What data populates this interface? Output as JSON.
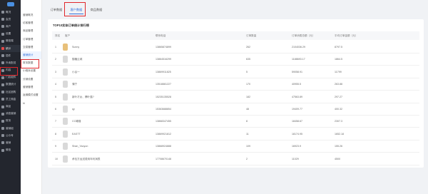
{
  "sidebar_main": {
    "items": [
      {
        "label": "概况",
        "active": false
      },
      {
        "label": "会员",
        "active": false
      },
      {
        "label": "商户",
        "active": false
      },
      {
        "label": "设置",
        "active": false
      },
      {
        "label": "微信端",
        "active": false
      },
      {
        "label": "统计",
        "active": true
      },
      {
        "label": "插件",
        "active": false
      },
      {
        "label": "外卖配送",
        "active": false
      },
      {
        "label": "内容",
        "active": false
      },
      {
        "label": "门店组件",
        "active": false
      },
      {
        "label": "数据统计",
        "active": false
      },
      {
        "label": "社区团购",
        "active": false
      },
      {
        "label": "员工佣金",
        "active": false
      },
      {
        "label": "商品",
        "active": false
      },
      {
        "label": "消息营销",
        "active": false
      },
      {
        "label": "财务",
        "active": false
      },
      {
        "label": "营销组",
        "active": false
      },
      {
        "label": "公众号",
        "active": false
      },
      {
        "label": "营销",
        "active": false
      },
      {
        "label": "微信",
        "active": false
      }
    ]
  },
  "sidebar_sub": {
    "items": [
      {
        "label": "营销概况",
        "active": false
      },
      {
        "label": "访客管理",
        "active": false
      },
      {
        "label": "商品管理",
        "active": false
      },
      {
        "label": "订单管理",
        "active": false
      },
      {
        "label": "交易管理",
        "active": false
      },
      {
        "label": "营销统计",
        "active": true
      },
      {
        "label": "财务数据",
        "active": false
      },
      {
        "label": "小程序设置",
        "active": false
      },
      {
        "label": "分销设置",
        "active": false
      },
      {
        "label": "营销管理",
        "active": false
      },
      {
        "label": "返佣模式设置",
        "active": false
      },
      {
        "label": "hi",
        "active": false
      }
    ]
  },
  "tabs": [
    {
      "label": "订单数据",
      "active": false
    },
    {
      "label": "客户数据",
      "active": true
    },
    {
      "label": "商品数据",
      "active": false
    }
  ],
  "card": {
    "title": "TOP10实体订单统计排行榜",
    "columns": [
      "排名",
      "客户",
      "联系电话",
      "订单数量",
      "订单消费总额（元）",
      "平均订单金额（元）"
    ],
    "rows": [
      {
        "rank": "1",
        "name": "Sunny",
        "phone": "13865874899",
        "count": "262",
        "total": "2104036.29",
        "avg": "8797.5"
      },
      {
        "rank": "2",
        "name": "御膳云城",
        "phone": "13864516299",
        "count": "635",
        "total": "1188693.17",
        "avg": "1864.5"
      },
      {
        "rank": "3",
        "name": "小谷一",
        "phone": "13869911825",
        "count": "5",
        "total": "59058.91",
        "avg": "11799"
      },
      {
        "rank": "4",
        "name": "蒲宁",
        "phone": "13518881227",
        "count": "170",
        "total": "40955.5",
        "avg": "263.88"
      },
      {
        "rank": "5",
        "name": "新叶才女、腾叶猫?",
        "phone": "15235135528",
        "count": "182",
        "total": "47563.89",
        "avg": "297.27"
      },
      {
        "rank": "6",
        "name": "qy",
        "phone": "15363688854",
        "count": "48",
        "total": "19409.77",
        "avg": "400.32"
      },
      {
        "rank": "7",
        "name": "CC曦瑾",
        "phone": "13868347455",
        "count": "8",
        "total": "18458.67",
        "avg": "2307.3"
      },
      {
        "rank": "8",
        "name": "EASTT",
        "phone": "13869921812",
        "count": "11",
        "total": "18174.95",
        "avg": "1652.18"
      },
      {
        "rank": "9",
        "name": "Shan_Yaoyun",
        "phone": "13868924888",
        "count": "109",
        "total": "16923.9",
        "avg": "155.26"
      },
      {
        "rank": "10",
        "name": "承包方运送费用年利润表",
        "phone": "17708670148",
        "count": "2",
        "total": "11029",
        "avg": "4500"
      }
    ]
  },
  "colors": {
    "accent": "#2f6fdb",
    "highlight": "#e0262b",
    "sidebar_bg": "#23262e"
  }
}
